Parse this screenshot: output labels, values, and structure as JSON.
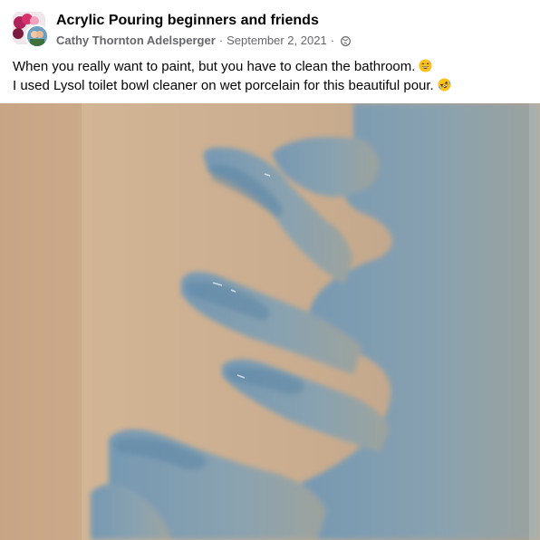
{
  "post": {
    "group_name": "Acrylic Pouring beginners and friends",
    "author": "Cathy Thornton Adelsperger",
    "separator": "·",
    "date": "September 2, 2021",
    "audience_icon": "globe-icon",
    "text_lines": [
      "When you really want to paint, but you have to clean the bathroom.",
      "I used Lysol toilet bowl cleaner on wet porcelain for this beautiful pour."
    ],
    "emojis": [
      "grinning-sweat-emoji",
      "rolling-laughing-emoji"
    ]
  },
  "photo": {
    "subject": "blue acrylic pour on beige porcelain",
    "colors": {
      "porcelain": "#c9a98a",
      "paint": "#7f9fb4",
      "paint_dark": "#5f86a3"
    }
  }
}
